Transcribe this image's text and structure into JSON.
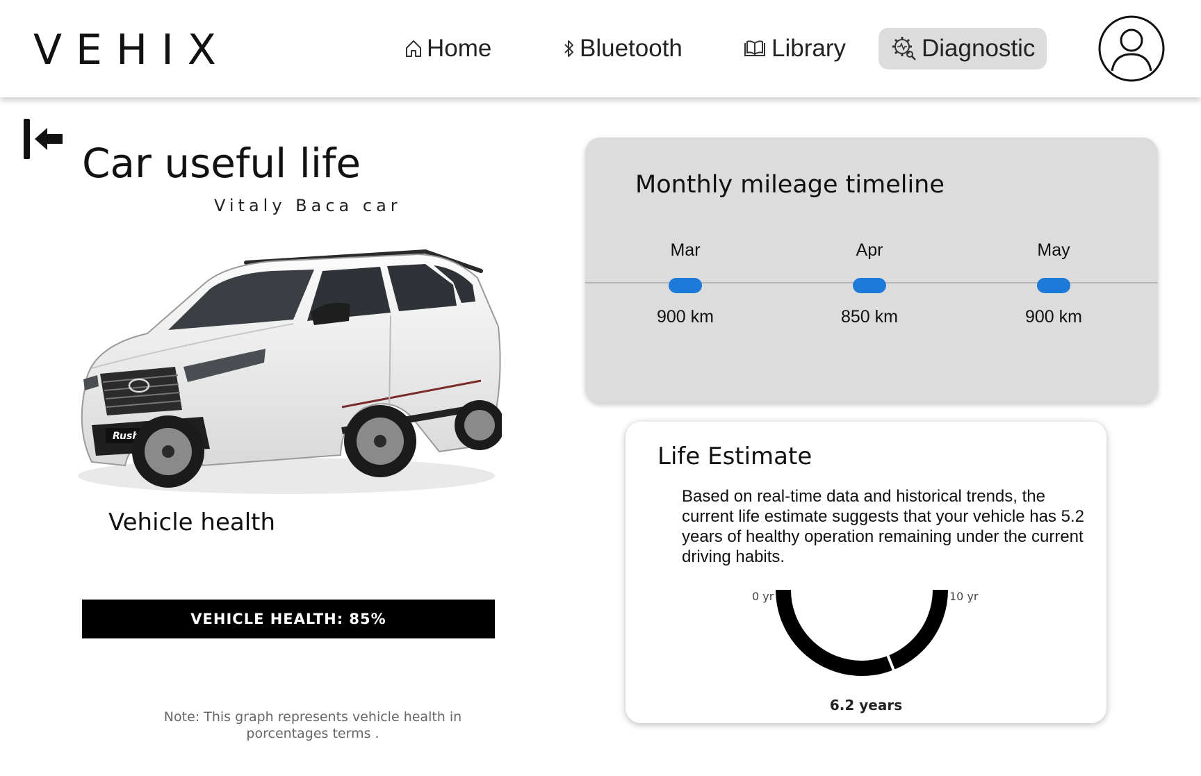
{
  "header": {
    "logo": "VEHIX",
    "nav": [
      {
        "label": "Home",
        "icon": "home-icon",
        "active": false
      },
      {
        "label": "Bluetooth",
        "icon": "bluetooth-icon",
        "active": false
      },
      {
        "label": "Library",
        "icon": "book-icon",
        "active": false
      },
      {
        "label": "Diagnostic",
        "icon": "diagnostic-gear-icon",
        "active": true
      }
    ],
    "avatar_icon": "user-icon"
  },
  "page": {
    "title": "Car useful life",
    "subtitle": "Vitaly Baca car",
    "back_icon": "back-arrow-icon"
  },
  "vehicle": {
    "health_label": "Vehicle health",
    "health_bar_text": "VEHICLE HEALTH: 85%",
    "health_percent": 85,
    "note": "Note: This graph represents vehicle health in porcentages terms ."
  },
  "mileage": {
    "title": "Monthly mileage timeline",
    "accent_color": "#1e7ad9",
    "items": [
      {
        "month": "Mar",
        "value": "900 km"
      },
      {
        "month": "Apr",
        "value": "850 km"
      },
      {
        "month": "May",
        "value": "900 km"
      }
    ]
  },
  "life_estimate": {
    "title": "Life Estimate",
    "description": "Based on real-time data and historical trends, the current life estimate suggests that your vehicle has 5.2 years of healthy operation remaining under the current driving habits.",
    "gauge_min_label": "0 yr",
    "gauge_max_label": "10 yr",
    "gauge_value_label": "6.2 years",
    "gauge_value": 6.2,
    "gauge_min": 0,
    "gauge_max": 10
  }
}
